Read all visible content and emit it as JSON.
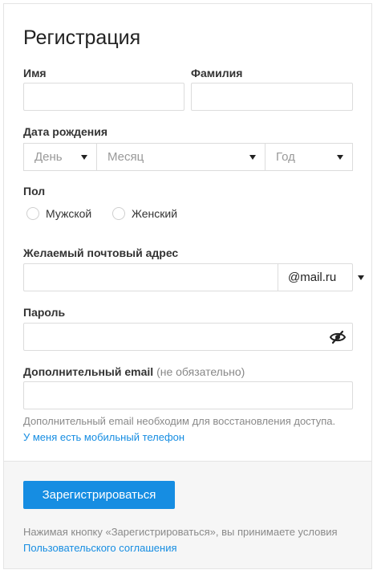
{
  "form": {
    "title": "Регистрация",
    "first_name_label": "Имя",
    "last_name_label": "Фамилия",
    "first_name_value": "",
    "last_name_value": "",
    "birth_label": "Дата рождения",
    "day_placeholder": "День",
    "month_placeholder": "Месяц",
    "year_placeholder": "Год",
    "gender_label": "Пол",
    "gender_male": "Мужской",
    "gender_female": "Женский",
    "email_label": "Желаемый почтовый адрес",
    "email_value": "",
    "email_domain": "@mail.ru",
    "password_label": "Пароль",
    "password_value": "",
    "extra_email_label": "Дополнительный email",
    "extra_email_optional": "(не обязательно)",
    "extra_email_value": "",
    "hint_text": "Дополнительный email необходим для восстановления доступа.",
    "hint_link": "У меня есть мобильный телефон"
  },
  "footer": {
    "register_button": "Зарегистрироваться",
    "terms_text": "Нажимая кнопку «Зарегистрироваться», вы принимаете условия",
    "terms_link": "Пользовательского соглашения"
  },
  "icons": {
    "password_toggle": "eye-slash-icon"
  },
  "colors": {
    "accent": "#168de2",
    "border": "#dcdcdc",
    "footer_bg": "#f6f6f6"
  }
}
